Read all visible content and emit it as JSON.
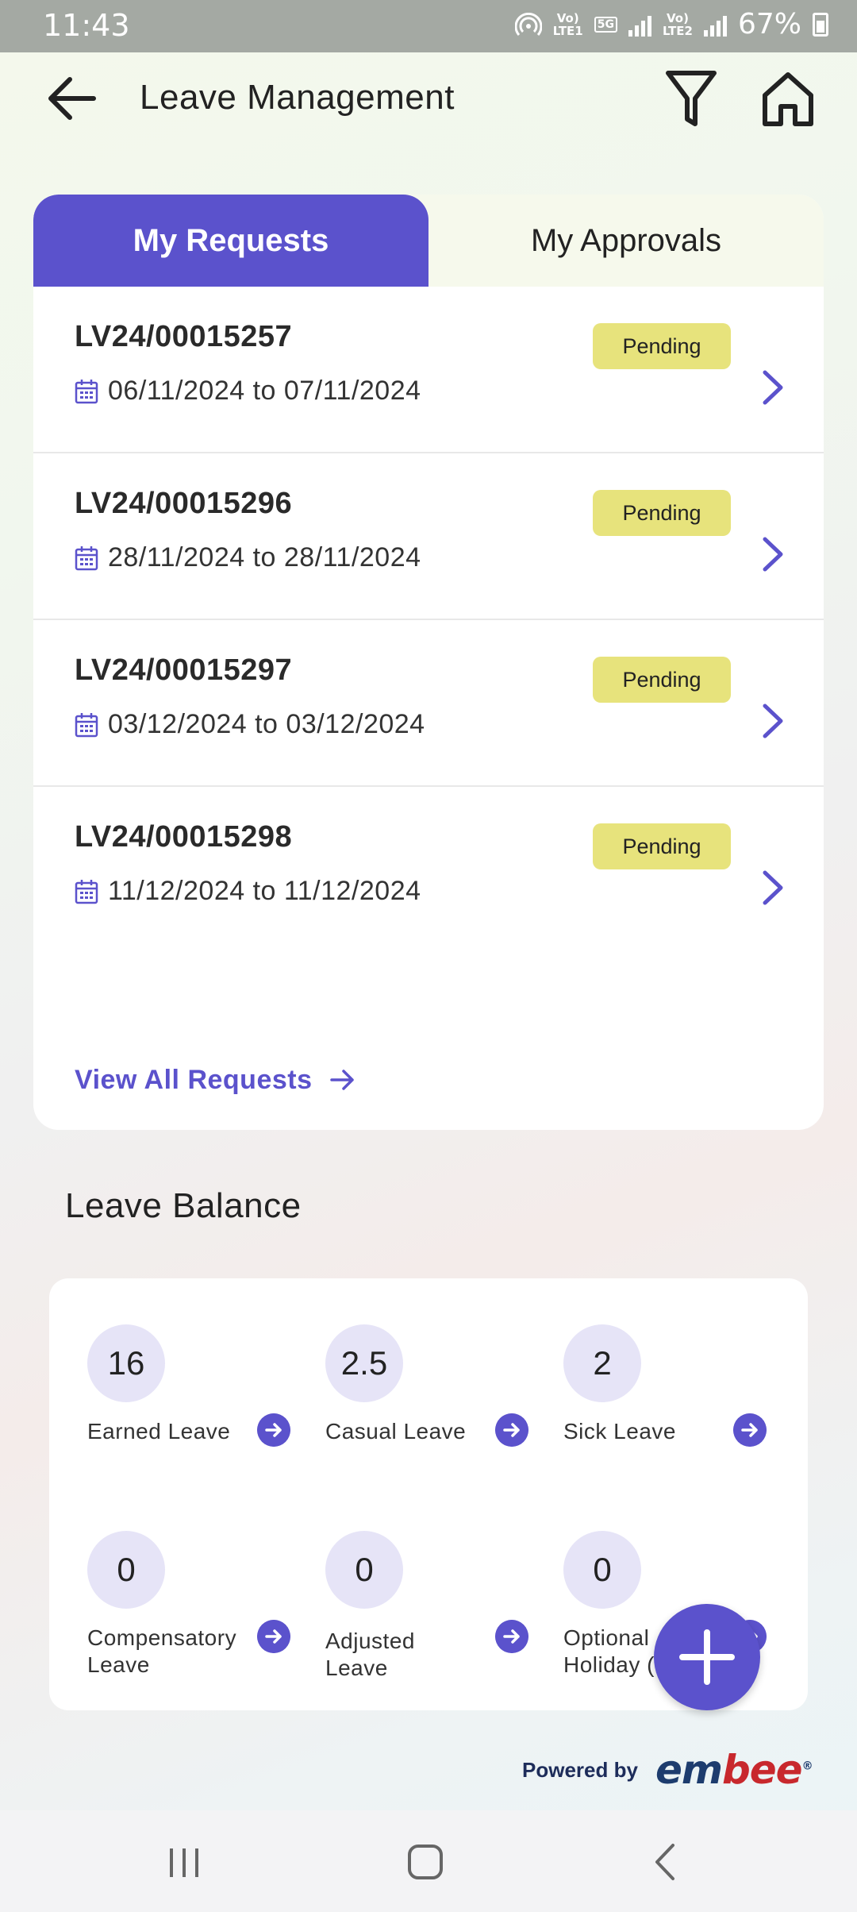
{
  "status_bar": {
    "time": "11:43",
    "sim1_label": "Vo)\nLTE1",
    "network": "5G",
    "sim2_label": "Vo)\nLTE2",
    "battery": "67%"
  },
  "header": {
    "title": "Leave Management",
    "back_icon": "arrow-left-icon",
    "filter_icon": "filter-icon",
    "home_icon": "home-icon"
  },
  "tabs": [
    {
      "label": "My Requests",
      "active": true
    },
    {
      "label": "My Approvals",
      "active": false
    }
  ],
  "requests": [
    {
      "id": "LV24/00015257",
      "dates": "06/11/2024 to 07/11/2024",
      "status": "Pending"
    },
    {
      "id": "LV24/00015296",
      "dates": "28/11/2024 to 28/11/2024",
      "status": "Pending"
    },
    {
      "id": "LV24/00015297",
      "dates": "03/12/2024 to 03/12/2024",
      "status": "Pending"
    },
    {
      "id": "LV24/00015298",
      "dates": "11/12/2024 to 11/12/2024",
      "status": "Pending"
    }
  ],
  "view_all": {
    "label": "View All Requests"
  },
  "leave_balance": {
    "title": "Leave Balance",
    "items": [
      {
        "value": "16",
        "label": "Earned Leave"
      },
      {
        "value": "2.5",
        "label": "Casual Leave"
      },
      {
        "value": "2",
        "label": "Sick Leave"
      },
      {
        "value": "0",
        "label": "Compensatory Leave"
      },
      {
        "value": "0",
        "label": "Adjusted Leave"
      },
      {
        "value": "0",
        "label": "Optional Holiday (RH)"
      }
    ]
  },
  "fab": {
    "icon": "plus-icon"
  },
  "footer": {
    "powered_by": "Powered by",
    "brand_part_1": "em",
    "brand_part_2": "bee",
    "brand_mark": "®"
  },
  "nav": {
    "recents_icon": "recents-icon",
    "home_icon": "nav-home-icon",
    "back_icon": "nav-back-icon"
  },
  "colors": {
    "accent": "#5b52cc",
    "pending": "#e7e37c",
    "status_bar": "#a4a9a3"
  }
}
